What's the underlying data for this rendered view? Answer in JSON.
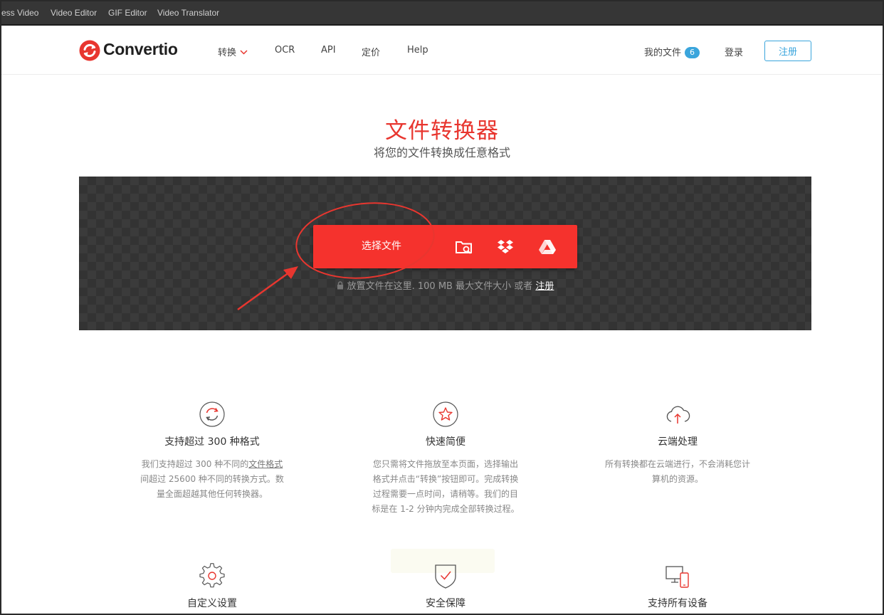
{
  "tool_strip": {
    "links": [
      "ess Video",
      "Video Editor",
      "GIF Editor",
      "Video Translator"
    ]
  },
  "header": {
    "logo_text": "Convertio",
    "nav": {
      "convert": "转换",
      "ocr": "OCR",
      "api": "API",
      "pricing": "定价",
      "help": "Help"
    },
    "my_files": "我的文件",
    "my_files_count": "6",
    "login": "登录",
    "signup": "注册"
  },
  "hero": {
    "title": "文件转换器",
    "subtitle": "将您的文件转换成任意格式"
  },
  "upload": {
    "select_label": "选择文件",
    "source_icons": [
      "folder-search-icon",
      "dropbox-icon",
      "google-drive-icon"
    ],
    "drop_hint": "放置文件在这里. 100 MB 最大文件大小 或者",
    "drop_hint_link": "注册"
  },
  "features": [
    {
      "icon": "refresh-icon",
      "title": "支持超过 300 种格式",
      "desc_lines": [
        "我们支持超过 300 种不同的",
        "文件格式",
        "间超过 25600 种不同的转换方式。数",
        "量全面超越其他任何转换器。"
      ]
    },
    {
      "icon": "star-icon",
      "title": "快速简便",
      "desc_lines": [
        "您只需将文件拖放至本页面，选择输出",
        "格式并点击“转换”按钮即可。完成转换",
        "过程需要一点时间，请稍等。我们的目",
        "标是在 1-2 分钟内完成全部转换过程。"
      ]
    },
    {
      "icon": "cloud-upload-icon",
      "title": "云端处理",
      "desc_lines": [
        "所有转换都在云端进行，不会消耗您计",
        "算机的资源。"
      ]
    }
  ],
  "bottom_features": [
    {
      "icon": "gear-icon",
      "title": "自定义设置"
    },
    {
      "icon": "shield-check-icon",
      "title": "安全保障"
    },
    {
      "icon": "devices-icon",
      "title": "支持所有设备"
    }
  ],
  "colors": {
    "brand_red": "#f5322d",
    "title_red": "#e8362f",
    "accent_blue": "#3aa5dc",
    "panel_dark": "#3b3b3b"
  }
}
